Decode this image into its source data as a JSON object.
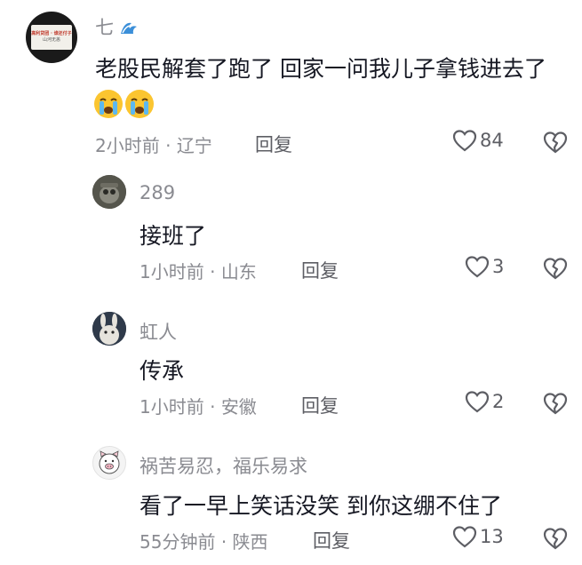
{
  "comments": [
    {
      "author": "七",
      "author_icon": "wave-icon",
      "avatar_text": [
        "高利贷团 · 谁还付子",
        "山河无恙"
      ],
      "text": "老股民解套了跑了 回家一问我儿子拿钱进去了",
      "emojis": [
        "crying-face-icon",
        "crying-face-icon"
      ],
      "time": "2小时前",
      "location": "辽宁",
      "reply_label": "回复",
      "likes": "84"
    },
    {
      "author": "289",
      "text": "接班了",
      "time": "1小时前",
      "location": "山东",
      "reply_label": "回复",
      "likes": "3"
    },
    {
      "author": "虹人",
      "text": "传承",
      "time": "1小时前",
      "location": "安徽",
      "reply_label": "回复",
      "likes": "2"
    },
    {
      "author": "祸苦易忍，福乐易求",
      "text": "看了一早上笑话没笑 到你这绷不住了",
      "time": "55分钟前",
      "location": "陕西",
      "reply_label": "回复",
      "likes": "13"
    }
  ],
  "meta_separator": "·"
}
